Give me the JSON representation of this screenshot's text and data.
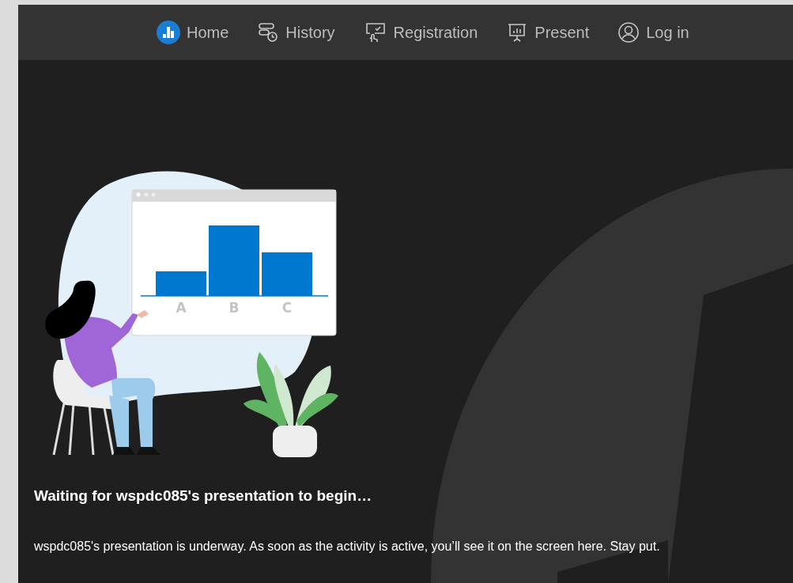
{
  "nav": {
    "items": [
      {
        "label": "Home",
        "kind": "home"
      },
      {
        "label": "History",
        "kind": "history"
      },
      {
        "label": "Registration",
        "kind": "registration"
      },
      {
        "label": "Present",
        "kind": "present"
      },
      {
        "label": "Log in",
        "kind": "login"
      }
    ]
  },
  "illustration": {
    "chart_labels": [
      "A",
      "B",
      "C"
    ]
  },
  "heading": "Waiting for wspdc085's presentation to begin…",
  "message": "wspdc085's presentation is underway. As soon as the activity is active, you’ll see it on the screen here. Stay put."
}
